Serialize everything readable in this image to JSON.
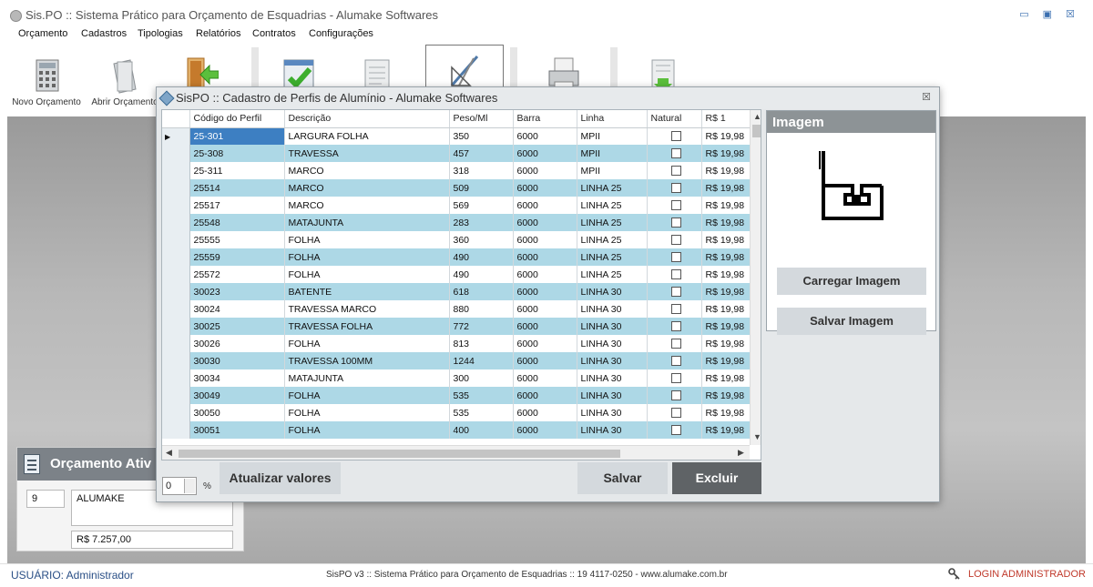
{
  "window": {
    "title": "Sis.PO :: Sistema Prático para Orçamento de Esquadrias - Alumake Softwares"
  },
  "menu": [
    "Orçamento",
    "Cadastros",
    "Tipologias",
    "Relatórios",
    "Contratos",
    "Configurações"
  ],
  "toolbar": {
    "items": [
      {
        "label": "Novo Orçamento",
        "icon": "calculator-icon"
      },
      {
        "label": "Abrir Orçamento",
        "icon": "open-document-icon"
      },
      {
        "label": "",
        "icon": "exit-door-icon"
      },
      {
        "label": "",
        "icon": "checklist-icon"
      },
      {
        "label": "",
        "icon": "document-icon"
      },
      {
        "label": "",
        "icon": "drawing-tools-icon"
      },
      {
        "label": "",
        "icon": "printer-icon"
      },
      {
        "label": "",
        "icon": "download-document-icon"
      }
    ]
  },
  "active_budget": {
    "title": "Orçamento Ativ",
    "number": "9",
    "client": "ALUMAKE",
    "total": "R$ 7.257,00"
  },
  "dialog": {
    "title": "SisPO :: Cadastro de Perfis de Alumínio - Alumake Softwares",
    "columns": [
      "Código do Perfil",
      "Descrição",
      "Peso/Ml",
      "Barra",
      "Linha",
      "Natural",
      "R$ 1"
    ],
    "rows": [
      {
        "code": "25-301",
        "desc": "LARGURA FOLHA",
        "peso": "350",
        "barra": "6000",
        "linha": "MPII",
        "natural": false,
        "preco": "R$ 19,98"
      },
      {
        "code": "25-308",
        "desc": "TRAVESSA",
        "peso": "457",
        "barra": "6000",
        "linha": "MPII",
        "natural": false,
        "preco": "R$ 19,98"
      },
      {
        "code": "25-311",
        "desc": "MARCO",
        "peso": "318",
        "barra": "6000",
        "linha": "MPII",
        "natural": false,
        "preco": "R$ 19,98"
      },
      {
        "code": "25514",
        "desc": "MARCO",
        "peso": "509",
        "barra": "6000",
        "linha": "LINHA 25",
        "natural": false,
        "preco": "R$ 19,98"
      },
      {
        "code": "25517",
        "desc": "MARCO",
        "peso": "569",
        "barra": "6000",
        "linha": "LINHA 25",
        "natural": false,
        "preco": "R$ 19,98"
      },
      {
        "code": "25548",
        "desc": "MATAJUNTA",
        "peso": "283",
        "barra": "6000",
        "linha": "LINHA 25",
        "natural": false,
        "preco": "R$ 19,98"
      },
      {
        "code": "25555",
        "desc": "FOLHA",
        "peso": "360",
        "barra": "6000",
        "linha": "LINHA 25",
        "natural": false,
        "preco": "R$ 19,98"
      },
      {
        "code": "25559",
        "desc": "FOLHA",
        "peso": "490",
        "barra": "6000",
        "linha": "LINHA 25",
        "natural": false,
        "preco": "R$ 19,98"
      },
      {
        "code": "25572",
        "desc": "FOLHA",
        "peso": "490",
        "barra": "6000",
        "linha": "LINHA 25",
        "natural": false,
        "preco": "R$ 19,98"
      },
      {
        "code": "30023",
        "desc": "BATENTE",
        "peso": "618",
        "barra": "6000",
        "linha": "LINHA 30",
        "natural": false,
        "preco": "R$ 19,98"
      },
      {
        "code": "30024",
        "desc": "TRAVESSA MARCO",
        "peso": "880",
        "barra": "6000",
        "linha": "LINHA 30",
        "natural": false,
        "preco": "R$ 19,98"
      },
      {
        "code": "30025",
        "desc": "TRAVESSA FOLHA",
        "peso": "772",
        "barra": "6000",
        "linha": "LINHA 30",
        "natural": false,
        "preco": "R$ 19,98"
      },
      {
        "code": "30026",
        "desc": "FOLHA",
        "peso": "813",
        "barra": "6000",
        "linha": "LINHA 30",
        "natural": false,
        "preco": "R$ 19,98"
      },
      {
        "code": "30030",
        "desc": "TRAVESSA 100MM",
        "peso": "1244",
        "barra": "6000",
        "linha": "LINHA 30",
        "natural": false,
        "preco": "R$ 19,98"
      },
      {
        "code": "30034",
        "desc": "MATAJUNTA",
        "peso": "300",
        "barra": "6000",
        "linha": "LINHA 30",
        "natural": false,
        "preco": "R$ 19,98"
      },
      {
        "code": "30049",
        "desc": "FOLHA",
        "peso": "535",
        "barra": "6000",
        "linha": "LINHA 30",
        "natural": false,
        "preco": "R$ 19,98"
      },
      {
        "code": "30050",
        "desc": "FOLHA",
        "peso": "535",
        "barra": "6000",
        "linha": "LINHA 30",
        "natural": false,
        "preco": "R$ 19,98"
      },
      {
        "code": "30051",
        "desc": "FOLHA",
        "peso": "400",
        "barra": "6000",
        "linha": "LINHA 30",
        "natural": false,
        "preco": "R$ 19,98"
      }
    ],
    "image_panel": {
      "title": "Imagem",
      "load_button": "Carregar Imagem",
      "save_button": "Salvar Imagem"
    },
    "percent_value": "0",
    "percent_sign": "%",
    "update_button": "Atualizar valores",
    "save_button": "Salvar",
    "delete_button": "Excluir"
  },
  "status": {
    "user": "USUÁRIO: Administrador",
    "center": "SisPO v3 :: Sistema Prático para Orçamento de Esquadrias  ::  19 4117-0250  -  www.alumake.com.br",
    "login": "LOGIN ADMINISTRADOR"
  },
  "colors": {
    "row_alt": "#add8e6",
    "selected_cell": "#3d7fc2",
    "delete_button_bg": "#5f6366",
    "login_text": "#c0392b"
  }
}
